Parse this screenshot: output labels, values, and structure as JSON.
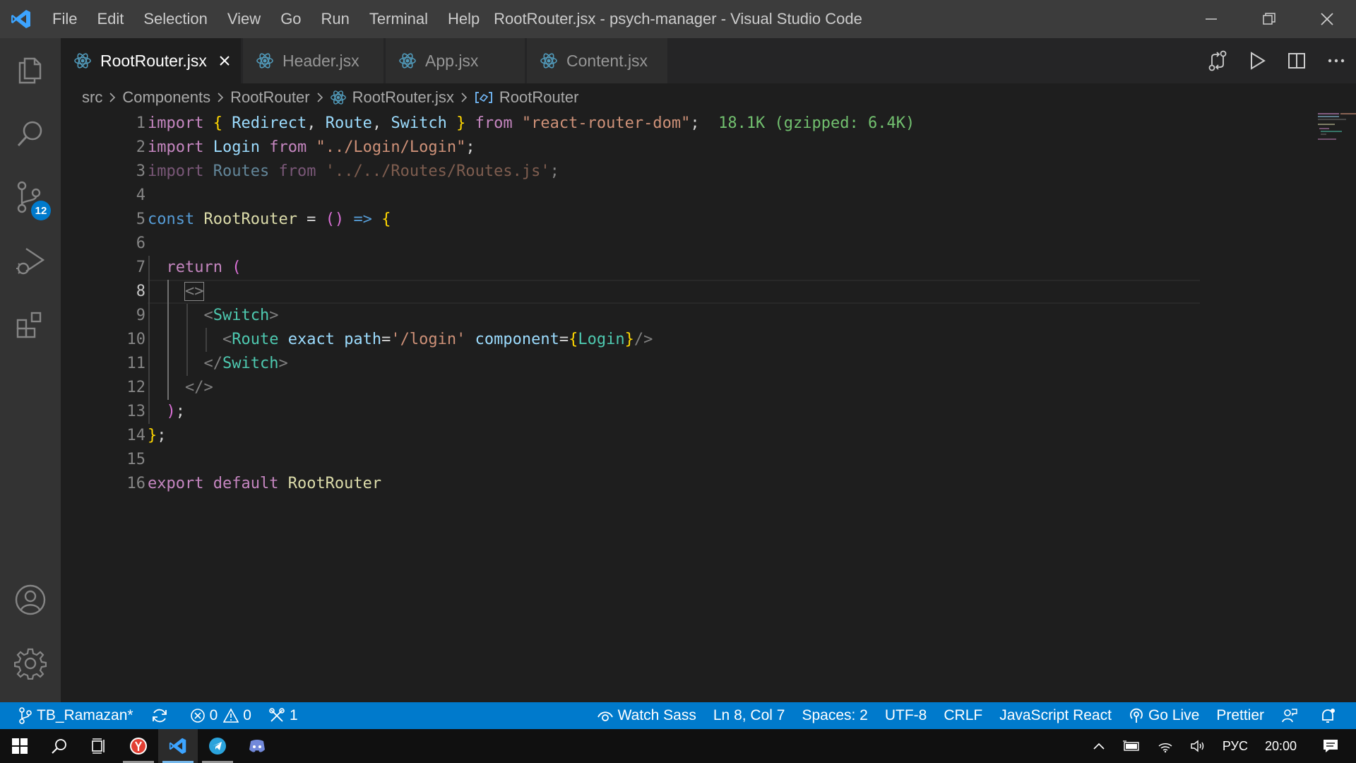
{
  "window": {
    "title": "RootRouter.jsx - psych-manager - Visual Studio Code",
    "menu": [
      "File",
      "Edit",
      "Selection",
      "View",
      "Go",
      "Run",
      "Terminal",
      "Help"
    ]
  },
  "activity_bar": {
    "items": [
      "explorer-icon",
      "search-icon",
      "source-control-icon",
      "run-debug-icon",
      "extensions-icon"
    ],
    "source_control_badge": "12",
    "bottom": [
      "account-icon",
      "settings-gear-icon"
    ]
  },
  "tabs": [
    {
      "label": "RootRouter.jsx",
      "active": true,
      "icon": "react-icon"
    },
    {
      "label": "Header.jsx",
      "active": false,
      "icon": "react-icon"
    },
    {
      "label": "App.jsx",
      "active": false,
      "icon": "react-icon"
    },
    {
      "label": "Content.jsx",
      "active": false,
      "icon": "react-icon"
    }
  ],
  "breadcrumbs": [
    "src",
    "Components",
    "RootRouter",
    "RootRouter.jsx",
    "RootRouter"
  ],
  "editor": {
    "line_numbers": [
      "1",
      "2",
      "3",
      "4",
      "5",
      "6",
      "7",
      "8",
      "9",
      "10",
      "11",
      "12",
      "13",
      "14",
      "15",
      "16"
    ],
    "current_line": 8,
    "tokens": {
      "import": "import",
      "from": "from",
      "const": "const",
      "return": "return",
      "export": "export",
      "default": "default",
      "redirect": "Redirect",
      "route": "Route",
      "switch": "Switch",
      "lib": "\"react-router-dom\"",
      "import_size": "18.1K (gzipped: 6.4K)",
      "login": "Login",
      "login_path": "\"../Login/Login\"",
      "routes": "Routes",
      "routes_path": "'../../Routes/Routes.js'",
      "root_router": "RootRouter",
      "exact": "exact",
      "path": "path",
      "login_route": "'/login'",
      "component": "component"
    }
  },
  "statusbar": {
    "branch": "TB_Ramazan*",
    "errors": "0",
    "warnings": "0",
    "tools": "1",
    "watch_sass": "Watch Sass",
    "position": "Ln 8, Col 7",
    "spaces": "Spaces: 2",
    "encoding": "UTF-8",
    "eol": "CRLF",
    "language": "JavaScript React",
    "go_live": "Go Live",
    "formatter": "Prettier"
  },
  "taskbar": {
    "apps": [
      "windows-start-icon",
      "search-icon",
      "task-view-icon",
      "yandex-browser-icon",
      "vscode-icon",
      "telegram-icon",
      "discord-icon"
    ],
    "language": "РУС",
    "time": "20:00"
  },
  "colors": {
    "statusbar": "#007acc",
    "editor_bg": "#1e1e1e",
    "titlebar": "#3c3c3c",
    "activity_bar": "#333333"
  }
}
